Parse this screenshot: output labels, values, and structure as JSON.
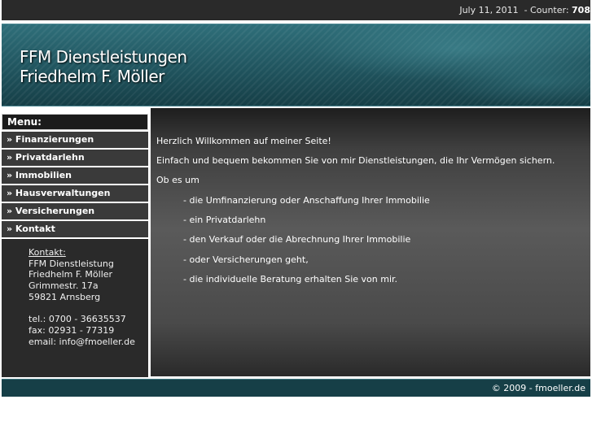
{
  "header": {
    "date": "July 11, 2011",
    "counter_label": "- Counter:",
    "counter_value": "708"
  },
  "banner": {
    "line1": "FFM Dienstleistungen",
    "line2": "Friedhelm F. Möller"
  },
  "menu": {
    "title": "Menu:",
    "items": [
      {
        "label": "» Finanzierungen"
      },
      {
        "label": "» Privatdarlehn"
      },
      {
        "label": "» Immobilien"
      },
      {
        "label": "» Hausverwaltungen"
      },
      {
        "label": "» Versicherungen"
      },
      {
        "label": "» Kontakt"
      }
    ]
  },
  "contact": {
    "heading": "Kontakt:",
    "company": "FFM Dienstleistung",
    "name": "Friedhelm F. Möller",
    "street": "Grimmestr. 17a",
    "city": "59821 Arnsberg",
    "tel": "tel.: 0700 - 36635537",
    "fax": "fax: 02931 - 77319",
    "email": "email: info@fmoeller.de"
  },
  "main": {
    "welcome": "Herzlich Willkommen auf meiner Seite!",
    "intro": "Einfach und bequem bekommen Sie von mir Dienstleistungen, die Ihr Vermögen sichern.",
    "lead": "Ob es um",
    "list": [
      "- die Umfinanzierung  oder Anschaffung Ihrer Immobilie",
      "- ein Privatdarlehn",
      "- den Verkauf oder die Abrechnung Ihrer Immobilie",
      "- oder Versicherungen geht,",
      "- die individuelle Beratung erhalten Sie von mir."
    ]
  },
  "footer": {
    "copyright": "© 2009 - fmoeller.de"
  }
}
